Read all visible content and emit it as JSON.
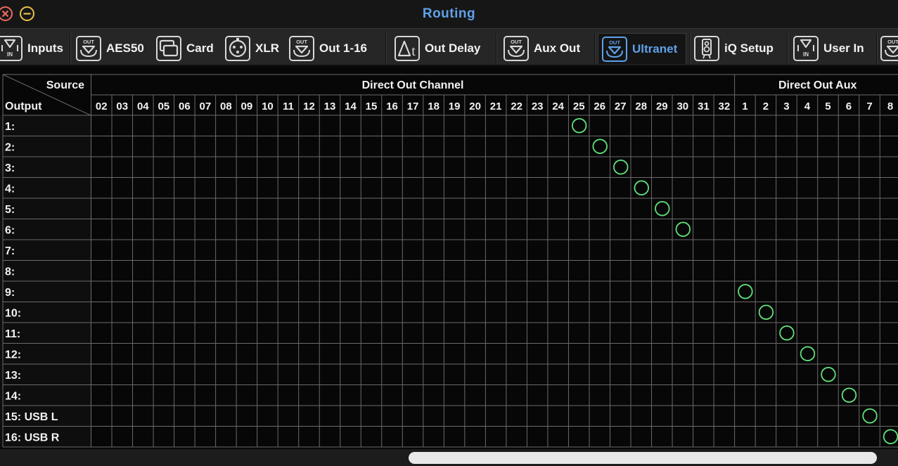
{
  "window": {
    "title": "Routing",
    "close_icon": "close-icon",
    "minimize_icon": "minimize-icon"
  },
  "tabs": [
    {
      "label": "Inputs",
      "icon": "in-arrow-icon",
      "active": false
    },
    {
      "label": "AES50",
      "icon": "out-arrow-icon",
      "active": false
    },
    {
      "label": "Card",
      "icon": "card-icon",
      "active": false
    },
    {
      "label": "XLR",
      "icon": "xlr-connector-icon",
      "active": false
    },
    {
      "label": "Out 1-16",
      "icon": "out-arrow-icon",
      "active": false
    },
    {
      "label": "Out Delay",
      "icon": "delta-t-icon",
      "active": false
    },
    {
      "label": "Aux Out",
      "icon": "out-arrow-icon",
      "active": false
    },
    {
      "label": "Ultranet",
      "icon": "out-arrow-icon",
      "active": true
    },
    {
      "label": "iQ Setup",
      "icon": "speaker-icon",
      "active": false
    },
    {
      "label": "User In",
      "icon": "in-arrow-icon",
      "active": false
    }
  ],
  "matrix": {
    "corner_source_label": "Source",
    "corner_output_label": "Output",
    "groups": [
      {
        "label": "Direct Out Channel",
        "columns": [
          "02",
          "03",
          "04",
          "05",
          "06",
          "07",
          "08",
          "09",
          "10",
          "11",
          "12",
          "13",
          "14",
          "15",
          "16",
          "17",
          "18",
          "19",
          "20",
          "21",
          "22",
          "23",
          "24",
          "25",
          "26",
          "27",
          "28",
          "29",
          "30",
          "31",
          "32"
        ]
      },
      {
        "label": "Direct Out Aux",
        "columns": [
          "1",
          "2",
          "3",
          "4",
          "5",
          "6",
          "7",
          "8"
        ]
      }
    ],
    "rows": [
      {
        "label": "1:",
        "routed_to": "25"
      },
      {
        "label": "2:",
        "routed_to": "26"
      },
      {
        "label": "3:",
        "routed_to": "27"
      },
      {
        "label": "4:",
        "routed_to": "28"
      },
      {
        "label": "5:",
        "routed_to": "29"
      },
      {
        "label": "6:",
        "routed_to": "30"
      },
      {
        "label": "7:",
        "routed_to": null
      },
      {
        "label": "8:",
        "routed_to": null
      },
      {
        "label": "9:",
        "routed_to": "Aux 1"
      },
      {
        "label": "10:",
        "routed_to": "Aux 2"
      },
      {
        "label": "11:",
        "routed_to": "Aux 3"
      },
      {
        "label": "12:",
        "routed_to": "Aux 4"
      },
      {
        "label": "13:",
        "routed_to": "Aux 5"
      },
      {
        "label": "14:",
        "routed_to": "Aux 6"
      },
      {
        "label": "15: USB L",
        "routed_to": "Aux 7"
      },
      {
        "label": "16: USB R",
        "routed_to": "Aux 8"
      }
    ],
    "colors": {
      "grid_line": "#6b6b6b",
      "route_marker": "#5fe07a",
      "cell_background": "#070707",
      "row_header_background": "#0e0e0e"
    }
  },
  "colors": {
    "accent": "#5fa1e8",
    "titlebar": "#161616",
    "tabbar": "#262626"
  }
}
